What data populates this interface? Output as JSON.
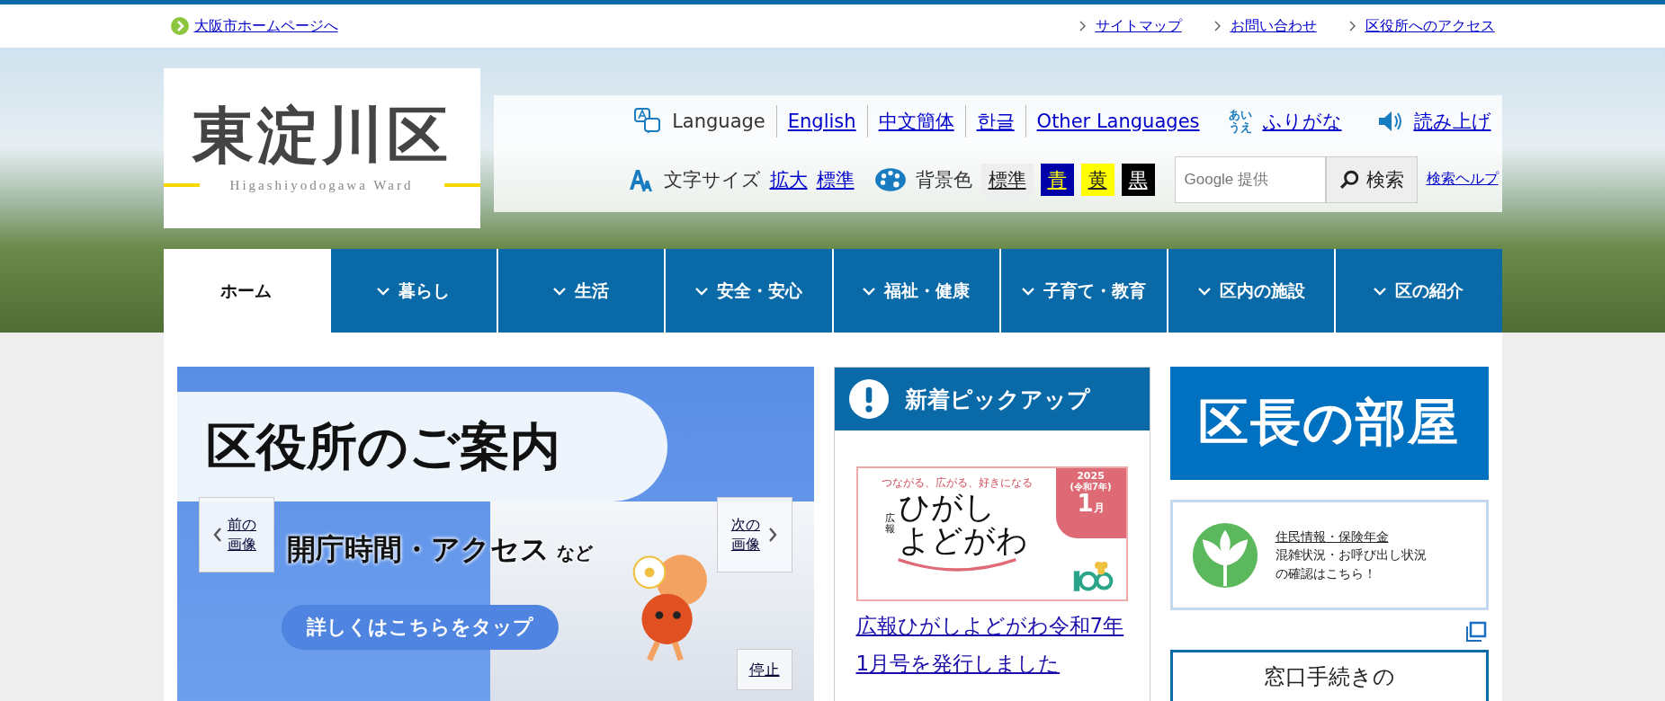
{
  "top_bar": {
    "home_link": "大阪市ホームページへ",
    "links": [
      "サイトマップ",
      "お問い合わせ",
      "区役所へのアクセス"
    ]
  },
  "logo": {
    "title": "東淀川区",
    "subtitle": "Higashiyodogawa Ward"
  },
  "tools": {
    "language_label": "Language",
    "languages": [
      "English",
      "中文簡体",
      "한글",
      "Other Languages"
    ],
    "furigana_icon": [
      "あい",
      "うえ"
    ],
    "furigana": "ふりがな",
    "read_aloud": "読み上げ",
    "text_size_label": "文字サイズ",
    "text_size_options": [
      "拡大",
      "標準"
    ],
    "bg_color_label": "背景色",
    "bg_colors": [
      {
        "label": "標準",
        "color": "#eeeeee"
      },
      {
        "label": "青",
        "color": "#0000a8"
      },
      {
        "label": "黄",
        "color": "#ffff00"
      },
      {
        "label": "黒",
        "color": "#000000"
      }
    ],
    "search": {
      "placeholder": "Google 提供",
      "button": "検索",
      "help": "検索ヘルプ"
    }
  },
  "nav": [
    {
      "label": "ホーム",
      "selected": true,
      "dropdown": false
    },
    {
      "label": "暮らし",
      "selected": false,
      "dropdown": true
    },
    {
      "label": "生活",
      "selected": false,
      "dropdown": true
    },
    {
      "label": "安全・安心",
      "selected": false,
      "dropdown": true
    },
    {
      "label": "福祉・健康",
      "selected": false,
      "dropdown": true
    },
    {
      "label": "子育て・教育",
      "selected": false,
      "dropdown": true
    },
    {
      "label": "区内の施設",
      "selected": false,
      "dropdown": true
    },
    {
      "label": "区の紹介",
      "selected": false,
      "dropdown": true
    }
  ],
  "slideshow": {
    "title": "区役所のご案内",
    "subtitle": "開庁時間・アクセス",
    "subtitle_suffix": "など",
    "button": "詳しくはこちらをタップ",
    "prev": "前の画像",
    "next": "次の画像",
    "pause": "停止"
  },
  "pickup": {
    "heading": "新着ピックアップ",
    "banner": {
      "tagline": "つながる、広がる、好きになる",
      "label": "広報",
      "title_lines": [
        "ひがし",
        "よどがわ"
      ],
      "year": "2025",
      "era": "(令和7年)",
      "month": "1",
      "month_unit": "月"
    },
    "link": "広報ひがしよどがわ令和7年1月号を発行しました"
  },
  "side": {
    "mayor_banner": "区長の部屋",
    "resident_banner": {
      "title": "住民情報・保険年金",
      "lines": [
        "混雑状況・お呼び出し状況",
        "の確認はこちら！"
      ]
    },
    "procedure_box": "窓口手続きの"
  }
}
